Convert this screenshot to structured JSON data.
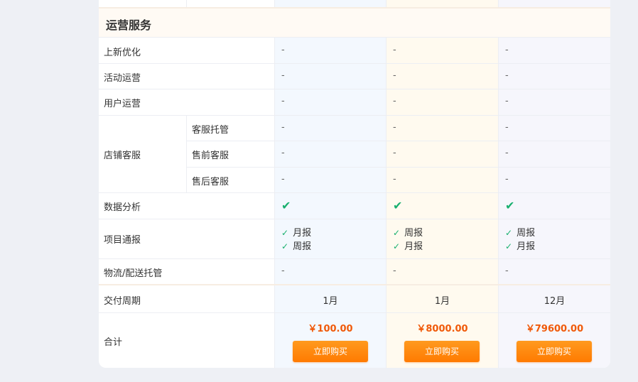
{
  "section_title": "运营服务",
  "rows": {
    "shangxin": "上新优化",
    "huodong": "活动运营",
    "yonghu": "用户运营",
    "dianpu": "店铺客服",
    "kefu_tuoguan": "客服托管",
    "shouqian": "售前客服",
    "shouhou": "售后客服",
    "shuju": "数据分析",
    "xiangmu": "项目通报",
    "wuliu": "物流/配送托管",
    "zhouqi": "交付周期",
    "heji": "合计"
  },
  "dash": "-",
  "check_glyph": "✔",
  "small_check": "✓",
  "plans": [
    {
      "reports": [
        "月报",
        "周报"
      ],
      "period": "1月",
      "price": "￥100.00",
      "buy": "立即购买"
    },
    {
      "reports": [
        "周报",
        "月报"
      ],
      "period": "1月",
      "price": "￥8000.00",
      "buy": "立即购买"
    },
    {
      "reports": [
        "周报",
        "月报"
      ],
      "period": "12月",
      "price": "￥79600.00",
      "buy": "立即购买"
    }
  ],
  "colors": {
    "accent": "#ff7a00",
    "price": "#f05a0a",
    "check": "#19b06f"
  }
}
